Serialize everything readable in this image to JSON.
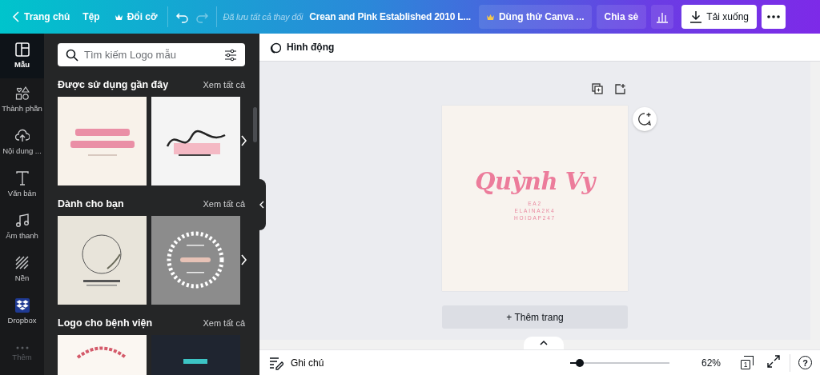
{
  "top_bar": {
    "home": "Trang chủ",
    "file_menu": "Tệp",
    "resize": "Đổi cỡ",
    "undo": {
      "disabled": false
    },
    "redo": {
      "disabled": true
    },
    "save_status": "Đã lưu tất cả thay đổi",
    "title": "Crean and Pink Established 2010 L...",
    "trial": "Dùng thử Canva ...",
    "share": "Chia sẻ",
    "download": "Tải xuống"
  },
  "side_rail": [
    {
      "kind": "templates",
      "label": "Mẫu",
      "selected": true,
      "disabled": false
    },
    {
      "kind": "elements",
      "label": "Thành phần",
      "selected": false,
      "disabled": false
    },
    {
      "kind": "uploads",
      "label": "Nội dung ...",
      "selected": false,
      "disabled": false
    },
    {
      "kind": "text",
      "label": "Văn bản",
      "selected": false,
      "disabled": false
    },
    {
      "kind": "audio",
      "label": "Âm thanh",
      "selected": false,
      "disabled": false
    },
    {
      "kind": "background",
      "label": "Nền",
      "selected": false,
      "disabled": false
    },
    {
      "kind": "dropbox",
      "label": "Dropbox",
      "selected": false,
      "disabled": false
    },
    {
      "kind": "more",
      "label": "Thêm",
      "selected": false,
      "disabled": true
    }
  ],
  "panel": {
    "search": {
      "placeholder": "Tìm kiếm Logo mẫu"
    },
    "sections": [
      {
        "title": "Được sử dụng gần đây",
        "link": "Xem tất cả"
      },
      {
        "title": "Dành cho bạn",
        "link": "Xem tất cả"
      },
      {
        "title": "Logo cho bệnh viện",
        "link": "Xem tất cả"
      }
    ]
  },
  "toolbar": {
    "animate": "Hình động"
  },
  "page": {
    "title": "Quỳnh Vy",
    "lines": [
      "EA2",
      "ELAINA2K4",
      "HOIDAP247"
    ]
  },
  "add_page": "+ Thêm trang",
  "bottom_bar": {
    "notes": "Ghi chú",
    "zoom": {
      "level": 0.1
    },
    "zoom_reading": "62%",
    "page_count": "1",
    "help": "?"
  }
}
